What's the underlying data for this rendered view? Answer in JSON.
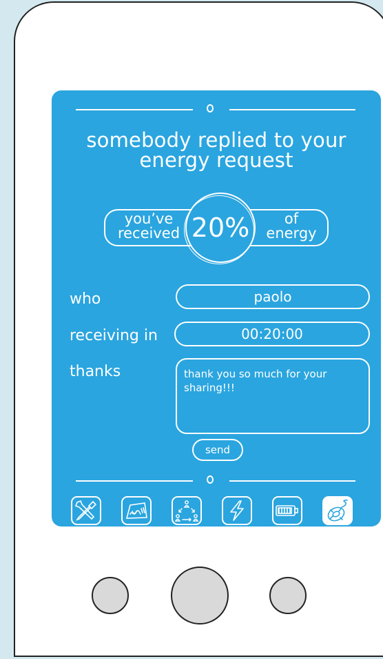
{
  "header": {
    "title": "somebody replied to your energy request"
  },
  "summary": {
    "left_line1": "you’ve",
    "left_line2": "received",
    "percent": "20%",
    "right_line1": "of",
    "right_line2": "energy"
  },
  "form": {
    "who_label": "who",
    "who_value": "paolo",
    "receiving_label": "receiving in",
    "receiving_value": "00:20:00",
    "thanks_label": "thanks",
    "thanks_value": "thank you so much for your sharing!!!",
    "send_label": "send"
  },
  "toolbar": {
    "items": [
      {
        "icon": "tools-icon",
        "active": false
      },
      {
        "icon": "map-icon",
        "active": false
      },
      {
        "icon": "community-cycle-icon",
        "active": false
      },
      {
        "icon": "lightning-icon",
        "active": false
      },
      {
        "icon": "battery-icon",
        "active": false
      },
      {
        "icon": "lifebuoy-icon",
        "active": true
      }
    ]
  },
  "colors": {
    "screen": "#2aa5df",
    "background": "#d3e9ef",
    "phone_body": "#ffffff",
    "hardware_buttons": "#d9d9d9"
  }
}
